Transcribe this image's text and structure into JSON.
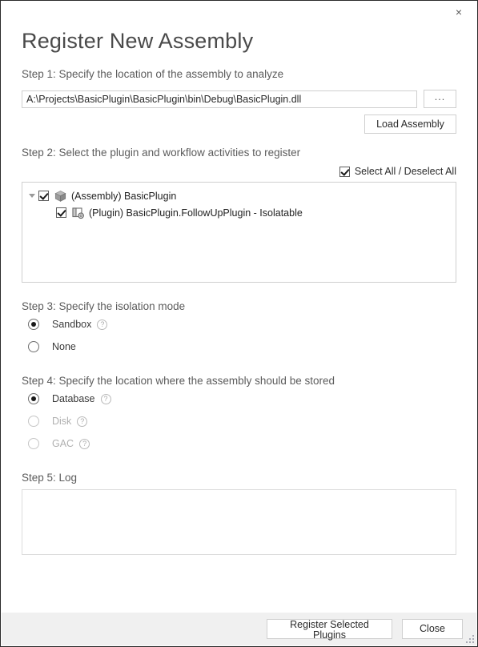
{
  "window": {
    "close_label": "×"
  },
  "title": "Register New Assembly",
  "step1": {
    "label": "Step 1: Specify the location of the assembly to analyze",
    "path_value": "A:\\Projects\\BasicPlugin\\BasicPlugin\\bin\\Debug\\BasicPlugin.dll",
    "path_placeholder": "",
    "browse_label": "...",
    "load_label": "Load Assembly"
  },
  "step2": {
    "label": "Step 2: Select the plugin and workflow activities to register",
    "select_all_label": "Select All / Deselect All",
    "select_all_checked": true,
    "tree": [
      {
        "label": "(Assembly) BasicPlugin",
        "icon": "assembly-package-icon",
        "checked": true,
        "expanded": true,
        "level": 0
      },
      {
        "label": "(Plugin) BasicPlugin.FollowUpPlugin - Isolatable",
        "icon": "plugin-gear-icon",
        "checked": true,
        "expanded": false,
        "level": 1
      }
    ]
  },
  "step3": {
    "label": "Step 3: Specify the isolation mode",
    "options": [
      {
        "label": "Sandbox",
        "selected": true,
        "disabled": false,
        "help": "?"
      },
      {
        "label": "None",
        "selected": false,
        "disabled": false,
        "help": ""
      }
    ]
  },
  "step4": {
    "label": "Step 4: Specify the location where the assembly should be stored",
    "options": [
      {
        "label": "Database",
        "selected": true,
        "disabled": false,
        "help": "?"
      },
      {
        "label": "Disk",
        "selected": false,
        "disabled": true,
        "help": "?"
      },
      {
        "label": "GAC",
        "selected": false,
        "disabled": true,
        "help": "?"
      }
    ]
  },
  "step5": {
    "label": "Step 5: Log",
    "log_value": ""
  },
  "footer": {
    "register_label": "Register Selected Plugins",
    "close_label": "Close"
  },
  "colors": {
    "window_border": "#2b2b2b",
    "footer_bg": "#f0f0f0",
    "label_text": "#5c5c5c",
    "title_text": "#4a4a4a",
    "field_border": "#cfcfcf",
    "disabled_text": "#b0b0b0"
  }
}
